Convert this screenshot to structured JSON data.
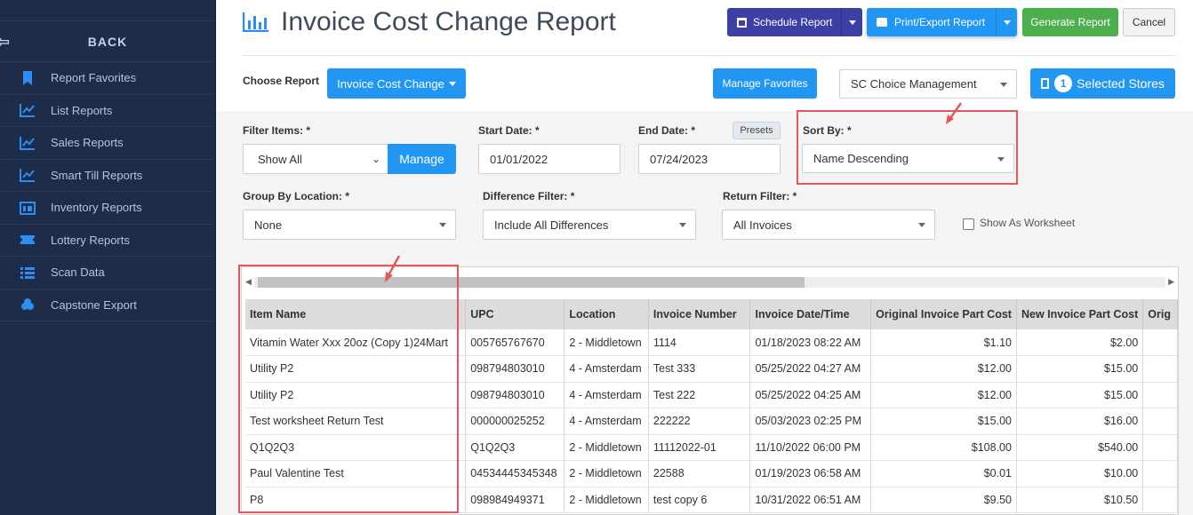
{
  "sidebar": {
    "back_label": "BACK",
    "items": [
      {
        "label": "Report Favorites",
        "icon": "bookmark-icon"
      },
      {
        "label": "List Reports",
        "icon": "line-chart-icon"
      },
      {
        "label": "Sales Reports",
        "icon": "line-chart-icon"
      },
      {
        "label": "Smart Till Reports",
        "icon": "line-chart-icon"
      },
      {
        "label": "Inventory Reports",
        "icon": "inventory-icon"
      },
      {
        "label": "Lottery Reports",
        "icon": "ticket-icon"
      },
      {
        "label": "Scan Data",
        "icon": "list-icon"
      },
      {
        "label": "Capstone Export",
        "icon": "cubes-icon"
      }
    ]
  },
  "header": {
    "title": "Invoice Cost Change Report",
    "schedule_label": "Schedule Report",
    "print_label": "Print/Export Report",
    "generate_label": "Generate Report",
    "cancel_label": "Cancel"
  },
  "choose": {
    "label": "Choose Report",
    "report_value": "Invoice Cost Change",
    "manage_favorites_label": "Manage Favorites",
    "company_value": "SC Choice Management",
    "selected_count": "1",
    "selected_label": "Selected Stores"
  },
  "filters": {
    "filter_items_label": "Filter Items: *",
    "filter_items_value": "Show All",
    "manage_label": "Manage",
    "start_date_label": "Start Date: *",
    "start_date_value": "01/01/2022",
    "end_date_label": "End Date: *",
    "end_date_value": "07/24/2023",
    "presets_label": "Presets",
    "sort_by_label": "Sort By: *",
    "sort_by_value": "Name Descending",
    "group_by_label": "Group By Location: *",
    "group_by_value": "None",
    "difference_label": "Difference Filter: *",
    "difference_value": "Include All Differences",
    "return_label": "Return Filter: *",
    "return_value": "All Invoices",
    "worksheet_label": "Show As Worksheet"
  },
  "table": {
    "columns": [
      "Item Name",
      "UPC",
      "Location",
      "Invoice Number",
      "Invoice Date/Time",
      "Original Invoice Part Cost",
      "New Invoice Part Cost",
      "Orig"
    ],
    "rows": [
      [
        "Vitamin Water Xxx 20oz (Copy 1)24Mart",
        "005765767670",
        "2 - Middletown",
        "1114",
        "01/18/2023 08:22 AM",
        "$1.10",
        "$2.00",
        ""
      ],
      [
        "Utility P2",
        "098794803010",
        "4 - Amsterdam",
        "Test 333",
        "05/25/2022 04:27 AM",
        "$12.00",
        "$15.00",
        ""
      ],
      [
        "Utility P2",
        "098794803010",
        "4 - Amsterdam",
        "Test 222",
        "05/25/2022 04:25 AM",
        "$12.00",
        "$15.00",
        ""
      ],
      [
        "Test worksheet Return Test",
        "000000025252",
        "4 - Amsterdam",
        "222222",
        "05/03/2023 02:25 PM",
        "$15.00",
        "$16.00",
        ""
      ],
      [
        "Q1Q2Q3",
        "Q1Q2Q3",
        "2 - Middletown",
        "11112022-01",
        "11/10/2022 06:00 PM",
        "$108.00",
        "$540.00",
        ""
      ],
      [
        "Paul Valentine Test",
        "04534445345348",
        "2 - Middletown",
        "22588",
        "01/19/2023 06:58 AM",
        "$0.01",
        "$10.00",
        ""
      ],
      [
        "P8",
        "098984949371",
        "2 - Middletown",
        "test copy 6",
        "10/31/2022 06:51 AM",
        "$9.50",
        "$10.50",
        ""
      ]
    ]
  },
  "colors": {
    "sidebar_bg": "#1d2c49",
    "navy_button": "#3c3fa3",
    "blue_button": "#2196f3",
    "green_button": "#4cae4c",
    "annotation_red": "#e05a5a"
  }
}
